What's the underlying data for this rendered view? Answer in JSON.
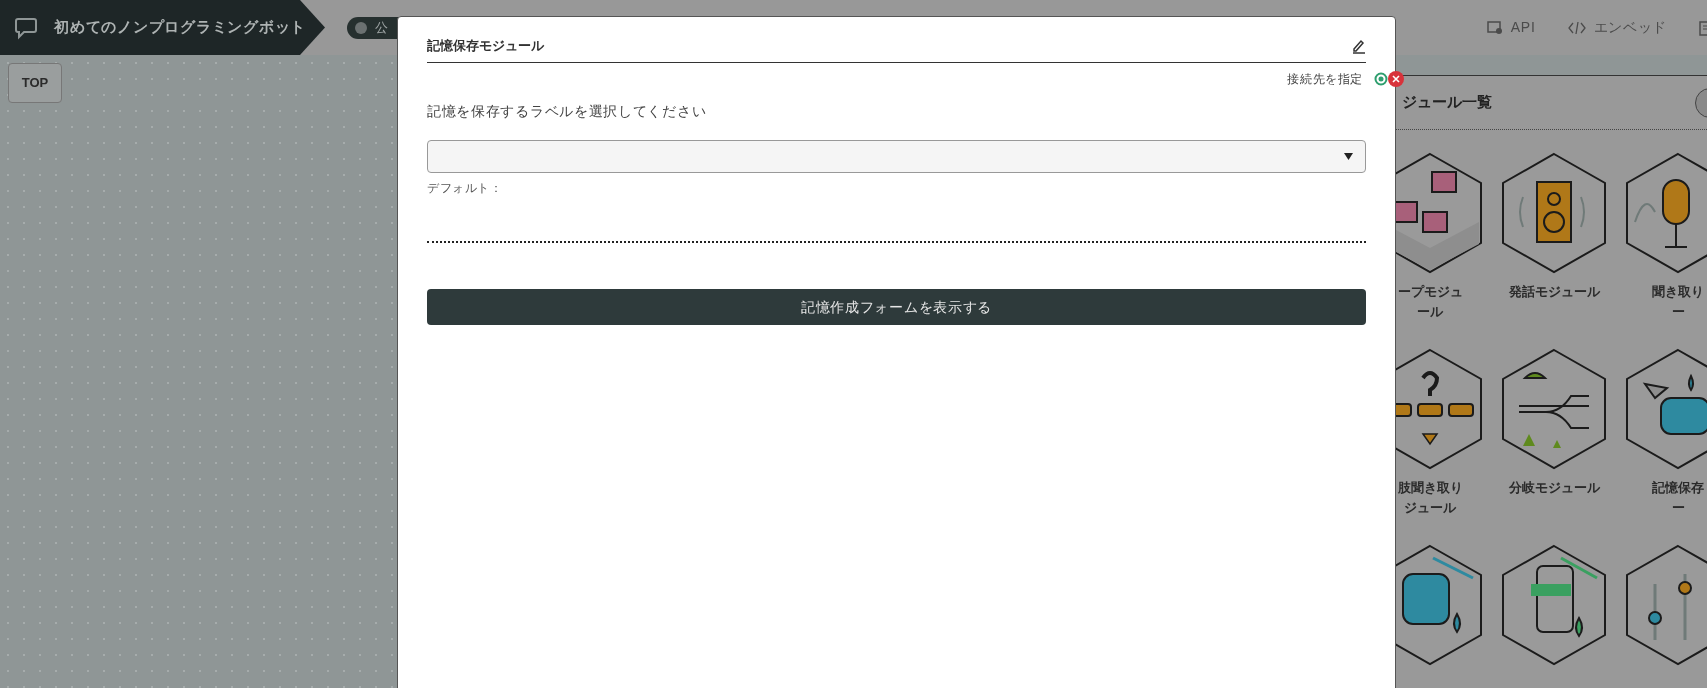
{
  "header": {
    "bot_title": "初めてのノンプログラミングボット",
    "publish_toggle": {
      "label": "公",
      "on": false
    },
    "links": [
      {
        "label": "API"
      },
      {
        "label": "エンベッド"
      }
    ]
  },
  "canvas": {
    "top_button": "TOP"
  },
  "module_panel": {
    "title": "ジュール一覧",
    "modules": [
      {
        "lines": [
          "ープモジュ",
          "ール"
        ]
      },
      {
        "lines": [
          "発話モジュール"
        ]
      },
      {
        "lines": [
          "聞き取り",
          "ー"
        ]
      },
      {
        "lines": [
          "肢聞き取り",
          "ジュール"
        ]
      },
      {
        "lines": [
          "分岐モジュール"
        ]
      },
      {
        "lines": [
          "記憶保存",
          "ー"
        ]
      }
    ]
  },
  "modal": {
    "title": "記憶保存モジュール",
    "connection_label": "接続先を指定",
    "field_label": "記憶を保存するラベルを選択してください",
    "default_label": "デフォルト：",
    "button": "記憶作成フォームを表示する"
  }
}
